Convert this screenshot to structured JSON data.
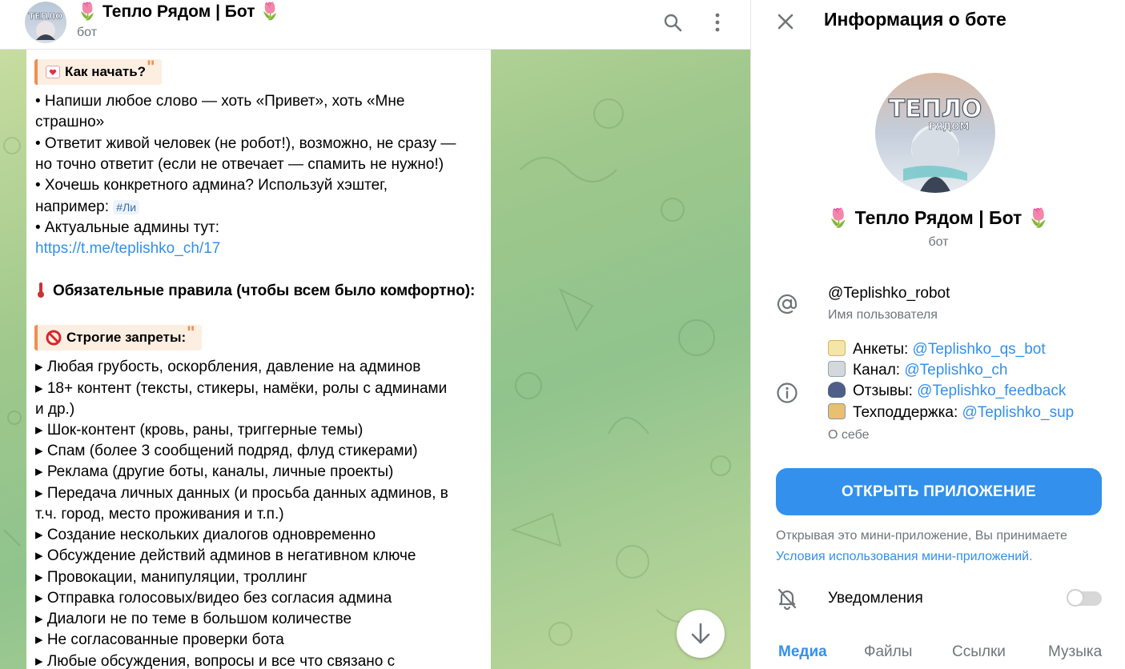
{
  "chat": {
    "title": "🌷 Тепло Рядом | Бот 🌷",
    "subtitle": "бот",
    "avatar_text": "ТЕПЛО",
    "message": {
      "how_to_start_heading": "Как начать?",
      "lines": [
        "• Напиши любое слово — хоть «Привет», хоть «Мне",
        "страшно»",
        "• Ответит живой человек (не робот!), возможно, не сразу —",
        "но точно ответит (если не отвечает — спамить не нужно!)",
        "• Хочешь конкретного админа? Используй хэштег,",
        "например: "
      ],
      "hashtag": "#Ли",
      "admins_line": "• Актуальные админы тут:",
      "admins_link": "https://t.me/teplishko_ch/17",
      "rules_heading": "Обязательные правила (чтобы всем было комфортно):",
      "bans_heading": "Строгие запреты:",
      "bans": [
        "▸  Любая грубость, оскорбления, давление на админов",
        "▸  18+ контент (тексты, стикеры, намёки, ролы с админами",
        "и др.)",
        "▸  Шок-контент (кровь, раны, триггерные темы)",
        "▸  Спам (более 3 сообщений подряд, флуд стикерами)",
        "▸  Реклама (другие боты, каналы, личные проекты)",
        "▸  Передача личных данных (и просьба данных админов, в",
        "т.ч. город, место проживания и т.п.)",
        "▸  Создание нескольких диалогов одновременно",
        "▸  Обсуждение действий админов в негативном ключе",
        "▸  Провокации, манипуляции, троллинг",
        "▸  Отправка голосовых/видео без согласия админа",
        "▸  Диалоги не по теме в большом количестве",
        "▸  Не согласованные проверки бота",
        "▸  Любые обсуждения, вопросы и все что связано с"
      ]
    }
  },
  "info": {
    "heading": "Информация о боте",
    "name": "🌷 Тепло Рядом | Бот 🌷",
    "type": "бот",
    "avatar_text": "ТЕПЛО",
    "avatar_subtext": "РЯДОМ",
    "username": "@Teplishko_robot",
    "username_label": "Имя пользователя",
    "bio": [
      {
        "label": "Анкеты: ",
        "link": "@Teplishko_qs_bot"
      },
      {
        "label": "Канал: ",
        "link": "@Teplishko_ch"
      },
      {
        "label": "Отзывы: ",
        "link": "@Teplishko_feedback"
      },
      {
        "label": "Техподдержка: ",
        "link": "@Teplishko_sup"
      }
    ],
    "bio_label": "О себе",
    "open_app": "ОТКРЫТЬ ПРИЛОЖЕНИЕ",
    "terms_text": "Открывая это мини-приложение, Вы принимаете",
    "terms_link": "Условия использования мини-приложений.",
    "notifications": "Уведомления",
    "notifications_on": false,
    "tabs": [
      "Медиа",
      "Файлы",
      "Ссылки",
      "Музыка"
    ],
    "active_tab": "Медиа"
  },
  "colors": {
    "accent": "#3390ec",
    "quote_bar": "#f08f4e",
    "wallpaper": "#9fc88c"
  }
}
